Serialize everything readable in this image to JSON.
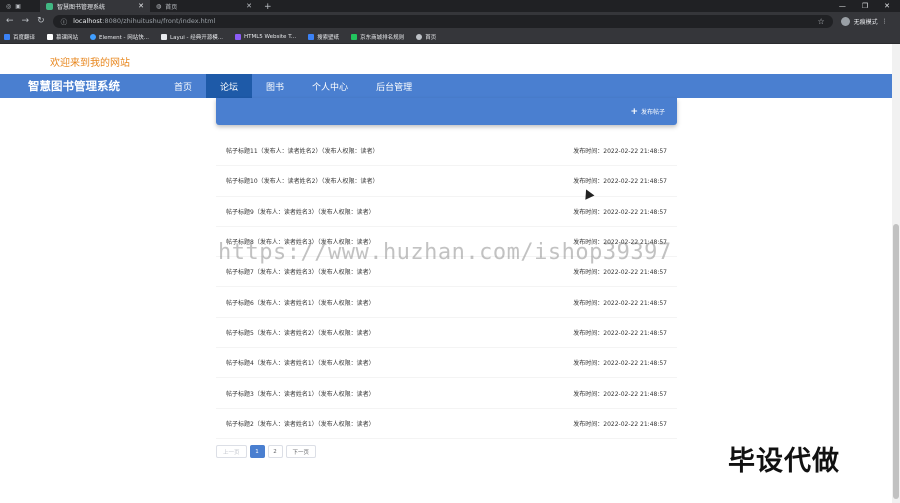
{
  "browser": {
    "tabs": [
      {
        "label": "智慧图书管理系统",
        "active": true,
        "favicon_color": "#41b883"
      },
      {
        "label": "首页",
        "active": false,
        "favicon_color": "#bdc1c6"
      }
    ],
    "url_host": "localhost",
    "url_rest": ":8080/zhihuitushu/front/index.html",
    "profile_label": "无痕模式",
    "bookmarks": [
      {
        "label": "百度翻译",
        "color": "#3b82f6"
      },
      {
        "label": "慕课网站",
        "color": "#ffffff"
      },
      {
        "label": "Element - 网站快...",
        "color": "#409eff"
      },
      {
        "label": "Layui - 经典开源模...",
        "color": "#e8eaed"
      },
      {
        "label": "HTML5 Website T...",
        "color": "#8b5cf6"
      },
      {
        "label": "搜索壁纸",
        "color": "#3b82f6"
      },
      {
        "label": "京东商城排名规则",
        "color": "#22c55e"
      },
      {
        "label": "首页",
        "color": "#bdc1c6"
      }
    ]
  },
  "site": {
    "welcome": "欢迎来到我的网站",
    "brand": "智慧图书管理系统",
    "nav": [
      {
        "label": "首页",
        "active": false
      },
      {
        "label": "论坛",
        "active": true
      },
      {
        "label": "图书",
        "active": false
      },
      {
        "label": "个人中心",
        "active": false
      },
      {
        "label": "后台管理",
        "active": false
      }
    ],
    "publish_label": "发布帖子"
  },
  "posts": [
    {
      "title": "帖子标题11（发布人：读者姓名2）（发布人权限：读者）",
      "time": "发布时间：2022-02-22 21:48:57"
    },
    {
      "title": "帖子标题10（发布人：读者姓名2）（发布人权限：读者）",
      "time": "发布时间：2022-02-22 21:48:57"
    },
    {
      "title": "帖子标题9（发布人：读者姓名3）（发布人权限：读者）",
      "time": "发布时间：2022-02-22 21:48:57"
    },
    {
      "title": "帖子标题8（发布人：读者姓名3）（发布人权限：读者）",
      "time": "发布时间：2022-02-22 21:48:57"
    },
    {
      "title": "帖子标题7（发布人：读者姓名3）（发布人权限：读者）",
      "time": "发布时间：2022-02-22 21:48:57"
    },
    {
      "title": "帖子标题6（发布人：读者姓名1）（发布人权限：读者）",
      "time": "发布时间：2022-02-22 21:48:57"
    },
    {
      "title": "帖子标题5（发布人：读者姓名2）（发布人权限：读者）",
      "time": "发布时间：2022-02-22 21:48:57"
    },
    {
      "title": "帖子标题4（发布人：读者姓名1）（发布人权限：读者）",
      "time": "发布时间：2022-02-22 21:48:57"
    },
    {
      "title": "帖子标题3（发布人：读者姓名1）（发布人权限：读者）",
      "time": "发布时间：2022-02-22 21:48:57"
    },
    {
      "title": "帖子标题2（发布人：读者姓名1）（发布人权限：读者）",
      "time": "发布时间：2022-02-22 21:48:57"
    }
  ],
  "pagination": {
    "prev": "上一页",
    "pages": [
      "1",
      "2"
    ],
    "current": "1",
    "next": "下一页"
  },
  "overlay": {
    "watermark": "https://www.huzhan.com/ishop39397",
    "stamp": "毕设代做"
  },
  "colors": {
    "brand_blue": "#4a7fd0",
    "active_nav": "#1e5aa8",
    "welcome_orange": "#e8871e"
  }
}
